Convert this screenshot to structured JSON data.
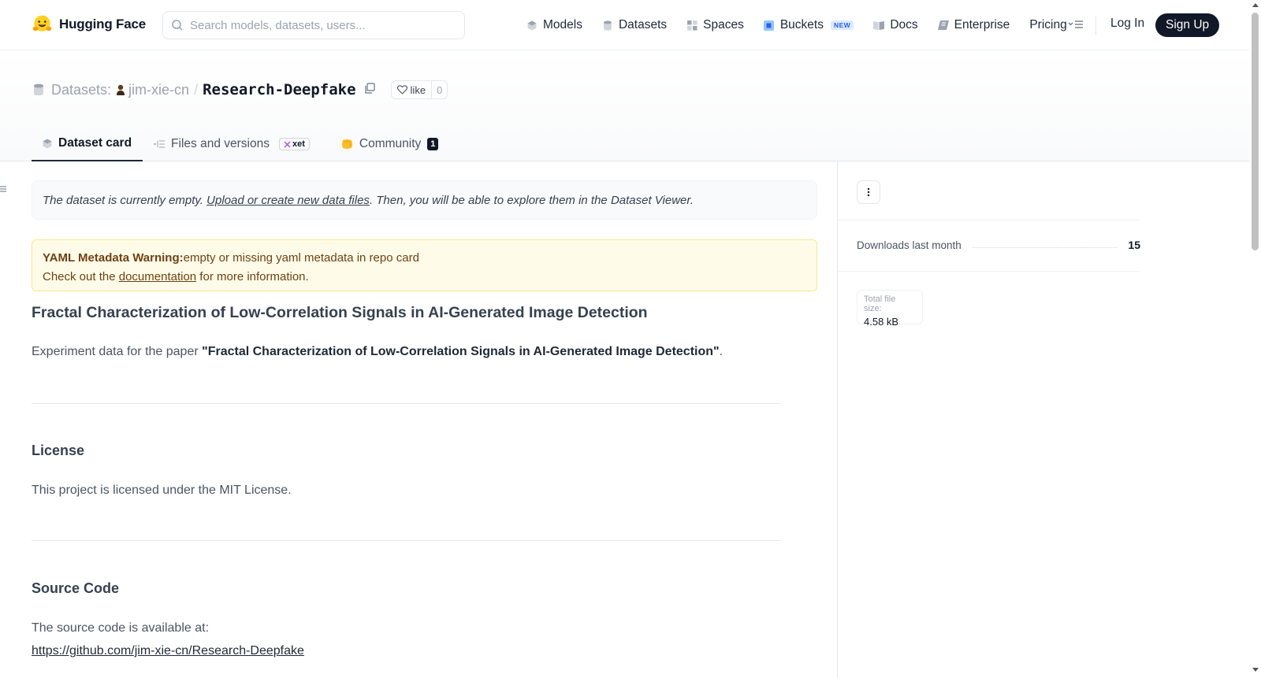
{
  "nav": {
    "brand": "Hugging Face",
    "search_placeholder": "Search models, datasets, users...",
    "links": {
      "models": "Models",
      "datasets": "Datasets",
      "spaces": "Spaces",
      "buckets": "Buckets",
      "buckets_badge": "NEW",
      "docs": "Docs",
      "enterprise": "Enterprise",
      "pricing": "Pricing"
    },
    "login": "Log In",
    "signup": "Sign Up"
  },
  "header": {
    "section_label": "Datasets:",
    "owner": "jim-xie-cn",
    "separator": "/",
    "repo_name": "Research-Deepfake",
    "like_label": "like",
    "like_count": "0"
  },
  "tabs": {
    "dataset_card": "Dataset card",
    "files": "Files and versions",
    "xet_badge": "xet",
    "community": "Community",
    "community_count": "1"
  },
  "main": {
    "empty_notice": {
      "prefix": "The dataset is currently empty. ",
      "link": "Upload or create new data files",
      "suffix": ". Then, you will be able to explore them in the Dataset Viewer."
    },
    "yaml_warning": {
      "title": "YAML Metadata Warning:",
      "message": "empty or missing yaml metadata in repo card",
      "line2_prefix": "Check out the ",
      "line2_link": "documentation",
      "line2_suffix": " for more information."
    },
    "heading": "Fractal Characterization of Low-Correlation Signals in AI-Generated Image Detection",
    "intro_prefix": "Experiment data for the paper ",
    "intro_bold": "\"Fractal Characterization of Low-Correlation Signals in AI-Generated Image Detection\"",
    "intro_suffix": ".",
    "license_heading": "License",
    "license_text": "This project is licensed under the MIT License.",
    "source_heading": "Source Code",
    "source_text": "The source code is available at:",
    "source_link": "https://github.com/jim-xie-cn/Research-Deepfake"
  },
  "sidebar": {
    "downloads_label": "Downloads last month",
    "downloads_value": "15",
    "filesize_label": "Total file size:",
    "filesize_value": "4.58 kB"
  },
  "colors": {
    "accent_dark": "#111827",
    "warning_bg": "#fefce8",
    "warning_text": "#713f12",
    "buckets_blue": "#2563eb"
  }
}
